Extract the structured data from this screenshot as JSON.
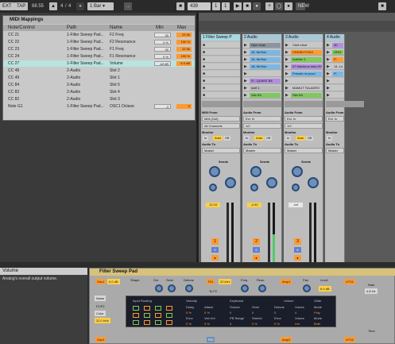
{
  "topbar": {
    "ext": "EXT",
    "tap": "TAP",
    "tempo": "88.55",
    "sig_num": "4",
    "sig_den": "4",
    "quant": "1 Bar",
    "position": "439",
    "pos_beat": "1",
    "pos_sixteenth": "1",
    "new": "NEW"
  },
  "midi_mappings": {
    "title": "MIDI Mappings",
    "headers": {
      "note": "Note/Control",
      "path": "Path",
      "name": "Name",
      "min": "Min",
      "max": "Max"
    },
    "rows": [
      {
        "note": "CC 21",
        "path": "1-Filter Sweep Pad...",
        "name": "F2 Freq",
        "min": "30",
        "max": "22.0k"
      },
      {
        "note": "CC 22",
        "path": "1-Filter Sweep Pad...",
        "name": "F2 Resonance",
        "min": "0 %",
        "max": "100 %"
      },
      {
        "note": "CC 23",
        "path": "1-Filter Sweep Pad...",
        "name": "F1 Freq",
        "min": "30",
        "max": "22.0k"
      },
      {
        "note": "CC 24",
        "path": "1-Filter Sweep Pad...",
        "name": "F1 Resonance",
        "min": "0 %",
        "max": "100 %"
      },
      {
        "note": "CC 27",
        "path": "1-Filter Sweep Pad...",
        "name": "Volume",
        "min": "-inf dB",
        "max": "6.0 dB"
      },
      {
        "note": "CC 48",
        "path": "2-Audio",
        "name": "Slot 2",
        "min": "",
        "max": ""
      },
      {
        "note": "CC 49",
        "path": "2-Audio",
        "name": "Slot 1",
        "min": "",
        "max": ""
      },
      {
        "note": "CC 84",
        "path": "2-Audio",
        "name": "Slot 5",
        "min": "",
        "max": ""
      },
      {
        "note": "CC 83",
        "path": "2-Audio",
        "name": "Slot 4",
        "min": "",
        "max": ""
      },
      {
        "note": "CC 82",
        "path": "2-Audio",
        "name": "Slot 3",
        "min": "",
        "max": ""
      },
      {
        "note": "Note G1",
        "path": "1-Filter Sweep Pad...",
        "name": "OSC1 Octave",
        "min": "-3",
        "max": "0"
      }
    ],
    "selected_index": 4
  },
  "tracks": [
    {
      "title": "1 Filter Sweep P",
      "clips": [],
      "input_label": "MIDI From",
      "input_value": "Midi (Out)",
      "input_channel": "All Channels",
      "monitor": "Monitor",
      "monitor_in": "In",
      "monitor_auto": "Auto",
      "monitor_off": "Off",
      "output_label": "Audio To",
      "output_value": "Master",
      "sends_label": "Sends",
      "volume": "12.03",
      "track_num": "1"
    },
    {
      "title": "2 Audio",
      "clips": [
        "Hpm chan",
        "15. Ne'Ibor",
        "16. Ne'Ibor",
        "18. Ne'Ibor",
        "",
        "57. QUAKE BE",
        "wolf 1",
        "SALSA"
      ],
      "input_label": "Audio From",
      "input_value": "Ext. In",
      "input_channel": "1/2",
      "monitor": "Monitor",
      "monitor_in": "In",
      "monitor_auto": "Auto",
      "monitor_off": "Off",
      "output_label": "Audio To",
      "output_value": "Master",
      "sends_label": "Sends",
      "volume": "-4.92",
      "track_num": "2"
    },
    {
      "title": "3 Audio",
      "clips": [
        "Cielt robot",
        "CRASH FOXX",
        "mathler 1",
        "57 Maximus tufon-RVRS_01-03",
        "Frescto no poco",
        "",
        "MAMUT TALADRO",
        "SALSA"
      ],
      "input_label": "Audio From",
      "input_value": "Ext. In",
      "input_channel": "1/2",
      "monitor": "Monitor",
      "monitor_in": "In",
      "monitor_auto": "Auto",
      "monitor_off": "Off",
      "output_label": "Audio To",
      "output_value": "Master",
      "sends_label": "Sends",
      "volume": "-inf",
      "track_num": "3"
    },
    {
      "title": "4 Audio",
      "clips": [
        "4K",
        "GRIZ",
        "Fi",
        "14. Lo",
        "Fi",
        "",
        "",
        ""
      ],
      "input_label": "Audio From",
      "input_value": "Ext. In",
      "input_channel": "",
      "monitor": "Monitor",
      "monitor_in": "In",
      "monitor_auto": "",
      "monitor_off": "",
      "output_label": "Audio To",
      "output_value": "Master",
      "sends_label": "",
      "volume": "",
      "track_num": ""
    }
  ],
  "info": {
    "title": "Volume",
    "text": "Analog's overall output volume."
  },
  "device": {
    "title": "Filter Sweep Pad",
    "osc1": "Osc1",
    "osc1_val": "0.0 dB",
    "shape": "Shape",
    "oct": "Oct",
    "semi": "Semi",
    "detune": "Detune",
    "f1": "Fil1",
    "f1_val": "22 kHz",
    "freq": "Freq",
    "reso": "Reso",
    "amp1": "Amp1",
    "pan": "Pan",
    "level": "Level",
    "lfo1": "LFO1",
    "rate": "Rate",
    "noise": "Noise",
    "color": "Color",
    "f1f2": "F1/F2",
    "osc2": "Osc2",
    "to_f2": "To F2",
    "input_routing": "Input Routing",
    "velocity": "Velocity",
    "keyboard": "Keyboard",
    "unison": "Unison",
    "glide": "Glide",
    "mm_row1": [
      "Delay",
      "Attack",
      "Octave",
      "Semi",
      "Detune",
      "Voices",
      "Mode"
    ],
    "mm_row2": [
      "Error",
      "Vel>Vol",
      "PB Range",
      "Stretch",
      "Error",
      "Voices",
      "Mode"
    ],
    "mm_vals": [
      "0 %",
      "0 %",
      "0",
      "0",
      "0",
      "4",
      "Poly"
    ],
    "mm_vals2": [
      "0 %",
      "0 %",
      "5",
      "0 %",
      "0 %",
      "Lim",
      "Both"
    ],
    "freq_val": "1kHz",
    "rate_val": "4.8 Hz",
    "level_val": "6.0 dB",
    "color_val": "22.0 kHz",
    "time_label": "Time"
  },
  "colors": {
    "accent": "#ff9a2e",
    "clip_orange": "#ff9a2e",
    "clip_green": "#80c860",
    "clip_purple": "#b28ee0",
    "clip_blue": "#78b8e8",
    "selected_row": "#b9e3df"
  }
}
